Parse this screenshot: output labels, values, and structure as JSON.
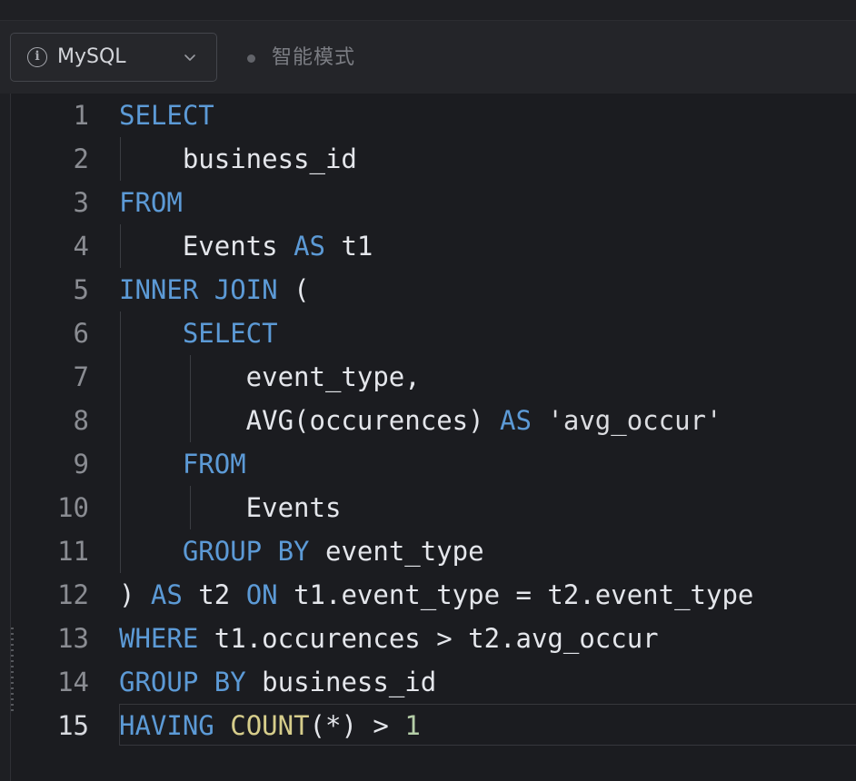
{
  "toolbar": {
    "language": "MySQL",
    "info_icon": "info-circle-icon",
    "chevron_icon": "chevron-down-icon",
    "mode_label": "智能模式"
  },
  "editor": {
    "active_line": 15,
    "lines": [
      {
        "n": "1",
        "tokens": [
          {
            "t": "SELECT",
            "c": "kw"
          }
        ]
      },
      {
        "n": "2",
        "tokens": [
          {
            "t": "    business_id",
            "c": ""
          }
        ]
      },
      {
        "n": "3",
        "tokens": [
          {
            "t": "FROM",
            "c": "kw"
          }
        ]
      },
      {
        "n": "4",
        "tokens": [
          {
            "t": "    Events ",
            "c": ""
          },
          {
            "t": "AS",
            "c": "kw"
          },
          {
            "t": " t1",
            "c": ""
          }
        ]
      },
      {
        "n": "5",
        "tokens": [
          {
            "t": "INNER JOIN",
            "c": "kw"
          },
          {
            "t": " (",
            "c": ""
          }
        ]
      },
      {
        "n": "6",
        "tokens": [
          {
            "t": "    ",
            "c": ""
          },
          {
            "t": "SELECT",
            "c": "kw"
          }
        ]
      },
      {
        "n": "7",
        "tokens": [
          {
            "t": "        event_type,",
            "c": ""
          }
        ]
      },
      {
        "n": "8",
        "tokens": [
          {
            "t": "        AVG(occurences) ",
            "c": ""
          },
          {
            "t": "AS",
            "c": "kw"
          },
          {
            "t": " 'avg_occur'",
            "c": "str"
          }
        ]
      },
      {
        "n": "9",
        "tokens": [
          {
            "t": "    ",
            "c": ""
          },
          {
            "t": "FROM",
            "c": "kw"
          }
        ]
      },
      {
        "n": "10",
        "tokens": [
          {
            "t": "        Events",
            "c": ""
          }
        ]
      },
      {
        "n": "11",
        "tokens": [
          {
            "t": "    ",
            "c": ""
          },
          {
            "t": "GROUP BY",
            "c": "kw"
          },
          {
            "t": " event_type",
            "c": ""
          }
        ]
      },
      {
        "n": "12",
        "tokens": [
          {
            "t": ") ",
            "c": ""
          },
          {
            "t": "AS",
            "c": "kw"
          },
          {
            "t": " t2 ",
            "c": ""
          },
          {
            "t": "ON",
            "c": "kw"
          },
          {
            "t": " t1.event_type = t2.event_type",
            "c": ""
          }
        ]
      },
      {
        "n": "13",
        "tokens": [
          {
            "t": "WHERE",
            "c": "kw"
          },
          {
            "t": " t1.occurences > t2.avg_occur",
            "c": ""
          }
        ]
      },
      {
        "n": "14",
        "tokens": [
          {
            "t": "GROUP BY",
            "c": "kw"
          },
          {
            "t": " business_id",
            "c": ""
          }
        ]
      },
      {
        "n": "15",
        "tokens": [
          {
            "t": "HAVING",
            "c": "kw"
          },
          {
            "t": " ",
            "c": ""
          },
          {
            "t": "COUNT",
            "c": "fn"
          },
          {
            "t": "(*) > ",
            "c": ""
          },
          {
            "t": "1",
            "c": "num"
          }
        ]
      }
    ]
  }
}
